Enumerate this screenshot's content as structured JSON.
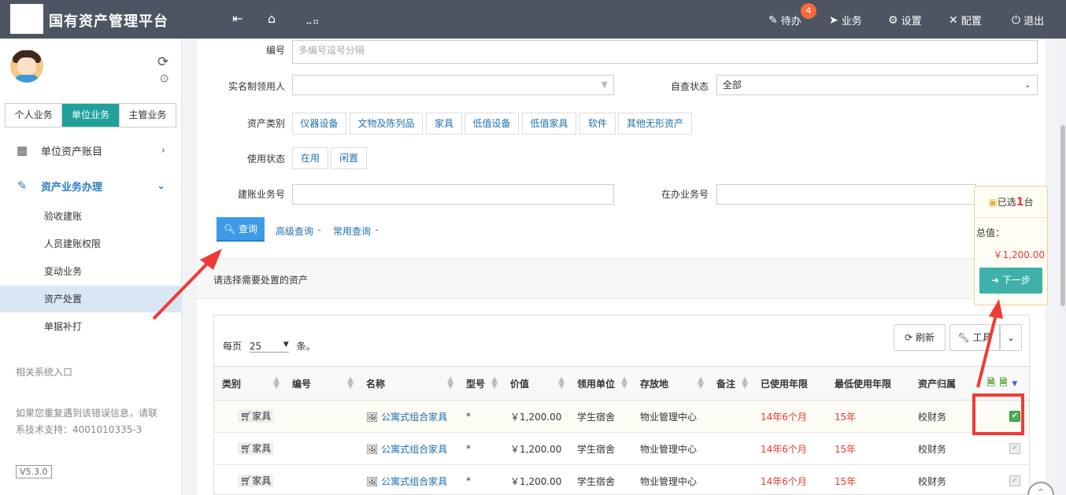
{
  "header": {
    "title": "国有资产管理平台",
    "nav": [
      {
        "icon": "edit-icon",
        "label": "待办"
      },
      {
        "icon": "send-icon",
        "label": "业务"
      },
      {
        "icon": "gear-icon",
        "label": "设置"
      },
      {
        "icon": "tools-icon",
        "label": "配置"
      },
      {
        "icon": "power-icon",
        "label": "退出"
      }
    ],
    "todo_badge": "4"
  },
  "sidebar": {
    "tabs": [
      {
        "label": "个人业务",
        "active": false
      },
      {
        "label": "单位业务",
        "active": true
      },
      {
        "label": "主管业务",
        "active": false
      }
    ],
    "menu": [
      {
        "label": "单位资产账目",
        "icon": "grid-icon"
      },
      {
        "label": "资产业务办理",
        "icon": "pencil-icon",
        "open": true
      }
    ],
    "sub_items": [
      {
        "label": "验收建账"
      },
      {
        "label": "人员建账权限"
      },
      {
        "label": "变动业务"
      },
      {
        "label": "资产处置",
        "active": true
      },
      {
        "label": "单据补打"
      }
    ],
    "related_label": "相关系统入口",
    "support_line1": "如果您重复遇到该错误信息，请联",
    "support_line2": "系技术支持：4001010335-3",
    "version": "V5.3.0"
  },
  "filters": {
    "number_label": "编号",
    "number_placeholder": "多编号逗号分隔",
    "owner_label": "实名制领用人",
    "owner_value": "",
    "check_status_label": "自查状态",
    "check_status_value": "全部",
    "category_label": "资产类别",
    "categories": [
      "仪器设备",
      "文物及陈列品",
      "家具",
      "低值设备",
      "低值家具",
      "软件",
      "其他无形资产"
    ],
    "usage_label": "使用状态",
    "usage_options": [
      "在用",
      "闲置"
    ],
    "account_biz_label": "建账业务号",
    "in_progress_biz_label": "在办业务号",
    "query_button": "查询",
    "advanced_query": "高级查询",
    "common_query": "常用查询"
  },
  "section": {
    "title": "请选择需要处置的资产"
  },
  "table": {
    "per_page_prefix": "每页",
    "per_page_value": "25",
    "per_page_suffix": "条。",
    "refresh_label": "刷新",
    "tools_label": "工具",
    "columns": [
      "类别",
      "编号",
      "名称",
      "型号",
      "价值",
      "领用单位",
      "存放地",
      "备注",
      "已使用年限",
      "最低使用年限",
      "资产归属"
    ],
    "rows": [
      {
        "category": "家具",
        "number": "",
        "name": "公寓式组合家具",
        "model": "*",
        "value": "￥1,200.00",
        "unit": "学生宿舍",
        "location": "物业管理中心",
        "note": "",
        "used_years": "14年6个月",
        "min_years": "15年",
        "owner": "校财务",
        "checked": true
      },
      {
        "category": "家具",
        "number": "",
        "name": "公寓式组合家具",
        "model": "*",
        "value": "￥1,200.00",
        "unit": "学生宿舍",
        "location": "物业管理中心",
        "note": "",
        "used_years": "14年6个月",
        "min_years": "15年",
        "owner": "校财务",
        "checked": false
      },
      {
        "category": "家具",
        "number": "",
        "name": "公寓式组合家具",
        "model": "*",
        "value": "￥1,200.00",
        "unit": "学生宿舍",
        "location": "物业管理中心",
        "note": "",
        "used_years": "14年6个月",
        "min_years": "15年",
        "owner": "校财务",
        "checked": false
      }
    ]
  },
  "selection_panel": {
    "selected_prefix": "已选",
    "selected_count": "1",
    "selected_suffix": "台",
    "total_label": "总值：",
    "total_value": "￥1,200.00",
    "next_button": "下一步"
  },
  "colors": {
    "topbar": "#4c5561",
    "accent_teal": "#20a29a",
    "link_blue": "#1f6fb1",
    "query_blue": "#3d9be8",
    "badge_orange": "#f5693d",
    "annotation_red": "#ef3b36"
  }
}
